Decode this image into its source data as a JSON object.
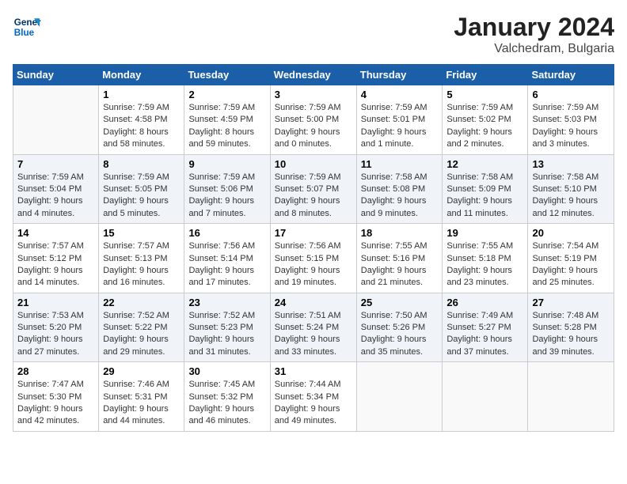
{
  "logo": {
    "line1": "General",
    "line2": "Blue"
  },
  "title": "January 2024",
  "location": "Valchedram, Bulgaria",
  "days_of_week": [
    "Sunday",
    "Monday",
    "Tuesday",
    "Wednesday",
    "Thursday",
    "Friday",
    "Saturday"
  ],
  "weeks": [
    [
      {
        "day": "",
        "info": ""
      },
      {
        "day": "1",
        "info": "Sunrise: 7:59 AM\nSunset: 4:58 PM\nDaylight: 8 hours\nand 58 minutes."
      },
      {
        "day": "2",
        "info": "Sunrise: 7:59 AM\nSunset: 4:59 PM\nDaylight: 8 hours\nand 59 minutes."
      },
      {
        "day": "3",
        "info": "Sunrise: 7:59 AM\nSunset: 5:00 PM\nDaylight: 9 hours\nand 0 minutes."
      },
      {
        "day": "4",
        "info": "Sunrise: 7:59 AM\nSunset: 5:01 PM\nDaylight: 9 hours\nand 1 minute."
      },
      {
        "day": "5",
        "info": "Sunrise: 7:59 AM\nSunset: 5:02 PM\nDaylight: 9 hours\nand 2 minutes."
      },
      {
        "day": "6",
        "info": "Sunrise: 7:59 AM\nSunset: 5:03 PM\nDaylight: 9 hours\nand 3 minutes."
      }
    ],
    [
      {
        "day": "7",
        "info": "Sunrise: 7:59 AM\nSunset: 5:04 PM\nDaylight: 9 hours\nand 4 minutes."
      },
      {
        "day": "8",
        "info": "Sunrise: 7:59 AM\nSunset: 5:05 PM\nDaylight: 9 hours\nand 5 minutes."
      },
      {
        "day": "9",
        "info": "Sunrise: 7:59 AM\nSunset: 5:06 PM\nDaylight: 9 hours\nand 7 minutes."
      },
      {
        "day": "10",
        "info": "Sunrise: 7:59 AM\nSunset: 5:07 PM\nDaylight: 9 hours\nand 8 minutes."
      },
      {
        "day": "11",
        "info": "Sunrise: 7:58 AM\nSunset: 5:08 PM\nDaylight: 9 hours\nand 9 minutes."
      },
      {
        "day": "12",
        "info": "Sunrise: 7:58 AM\nSunset: 5:09 PM\nDaylight: 9 hours\nand 11 minutes."
      },
      {
        "day": "13",
        "info": "Sunrise: 7:58 AM\nSunset: 5:10 PM\nDaylight: 9 hours\nand 12 minutes."
      }
    ],
    [
      {
        "day": "14",
        "info": "Sunrise: 7:57 AM\nSunset: 5:12 PM\nDaylight: 9 hours\nand 14 minutes."
      },
      {
        "day": "15",
        "info": "Sunrise: 7:57 AM\nSunset: 5:13 PM\nDaylight: 9 hours\nand 16 minutes."
      },
      {
        "day": "16",
        "info": "Sunrise: 7:56 AM\nSunset: 5:14 PM\nDaylight: 9 hours\nand 17 minutes."
      },
      {
        "day": "17",
        "info": "Sunrise: 7:56 AM\nSunset: 5:15 PM\nDaylight: 9 hours\nand 19 minutes."
      },
      {
        "day": "18",
        "info": "Sunrise: 7:55 AM\nSunset: 5:16 PM\nDaylight: 9 hours\nand 21 minutes."
      },
      {
        "day": "19",
        "info": "Sunrise: 7:55 AM\nSunset: 5:18 PM\nDaylight: 9 hours\nand 23 minutes."
      },
      {
        "day": "20",
        "info": "Sunrise: 7:54 AM\nSunset: 5:19 PM\nDaylight: 9 hours\nand 25 minutes."
      }
    ],
    [
      {
        "day": "21",
        "info": "Sunrise: 7:53 AM\nSunset: 5:20 PM\nDaylight: 9 hours\nand 27 minutes."
      },
      {
        "day": "22",
        "info": "Sunrise: 7:52 AM\nSunset: 5:22 PM\nDaylight: 9 hours\nand 29 minutes."
      },
      {
        "day": "23",
        "info": "Sunrise: 7:52 AM\nSunset: 5:23 PM\nDaylight: 9 hours\nand 31 minutes."
      },
      {
        "day": "24",
        "info": "Sunrise: 7:51 AM\nSunset: 5:24 PM\nDaylight: 9 hours\nand 33 minutes."
      },
      {
        "day": "25",
        "info": "Sunrise: 7:50 AM\nSunset: 5:26 PM\nDaylight: 9 hours\nand 35 minutes."
      },
      {
        "day": "26",
        "info": "Sunrise: 7:49 AM\nSunset: 5:27 PM\nDaylight: 9 hours\nand 37 minutes."
      },
      {
        "day": "27",
        "info": "Sunrise: 7:48 AM\nSunset: 5:28 PM\nDaylight: 9 hours\nand 39 minutes."
      }
    ],
    [
      {
        "day": "28",
        "info": "Sunrise: 7:47 AM\nSunset: 5:30 PM\nDaylight: 9 hours\nand 42 minutes."
      },
      {
        "day": "29",
        "info": "Sunrise: 7:46 AM\nSunset: 5:31 PM\nDaylight: 9 hours\nand 44 minutes."
      },
      {
        "day": "30",
        "info": "Sunrise: 7:45 AM\nSunset: 5:32 PM\nDaylight: 9 hours\nand 46 minutes."
      },
      {
        "day": "31",
        "info": "Sunrise: 7:44 AM\nSunset: 5:34 PM\nDaylight: 9 hours\nand 49 minutes."
      },
      {
        "day": "",
        "info": ""
      },
      {
        "day": "",
        "info": ""
      },
      {
        "day": "",
        "info": ""
      }
    ]
  ]
}
